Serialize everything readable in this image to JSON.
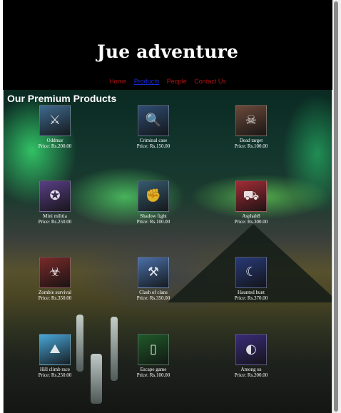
{
  "site": {
    "title": "Jue adventure"
  },
  "nav": {
    "items": [
      {
        "label": "Home",
        "active": false
      },
      {
        "label": "Products",
        "active": true
      },
      {
        "label": "People",
        "active": false
      },
      {
        "label": "Contact Us",
        "active": false
      }
    ]
  },
  "main": {
    "heading": "Our Premium Products",
    "products": [
      {
        "name": "Oddmar",
        "price": "Price: Rs.200.00",
        "icon": "viking-icon",
        "color": "#3f6b8f"
      },
      {
        "name": "Criminal case",
        "price": "Price: Rs.150.00",
        "icon": "detective-icon",
        "color": "#2f4d74"
      },
      {
        "name": "Dead target",
        "price": "Price: Rs.100.00",
        "icon": "zombie-icon",
        "color": "#6b4a3a"
      },
      {
        "name": "Mini militia",
        "price": "Price: Rs.250.00",
        "icon": "soldier-icon",
        "color": "#5a3f86"
      },
      {
        "name": "Shadow fight",
        "price": "Price: Rs.100.00",
        "icon": "fighter-icon",
        "color": "#355a6e"
      },
      {
        "name": "Asphalt8",
        "price": "Price: Rs.300.00",
        "icon": "race-car-icon",
        "color": "#a32c36"
      },
      {
        "name": "Zombie survival",
        "price": "Price: Rs.350.00",
        "icon": "zombie-survivor-icon",
        "color": "#7a2a2a"
      },
      {
        "name": "Clash of clans",
        "price": "Price: Rs.350.00",
        "icon": "barbarian-icon",
        "color": "#4a6fa8"
      },
      {
        "name": "Haunted hunt",
        "price": "Price: Rs.370.00",
        "icon": "haunted-icon",
        "color": "#283a78"
      },
      {
        "name": "Hill climb race",
        "price": "Price: Rs.250.00",
        "icon": "hill-climb-icon",
        "color": "#48a6d8"
      },
      {
        "name": "Escape game",
        "price": "Price: Rs.100.00",
        "icon": "escape-door-icon",
        "color": "#1f5a2a"
      },
      {
        "name": "Among us",
        "price": "Price: Rs.200.00",
        "icon": "crewmate-icon",
        "color": "#3a2c7a"
      }
    ]
  }
}
